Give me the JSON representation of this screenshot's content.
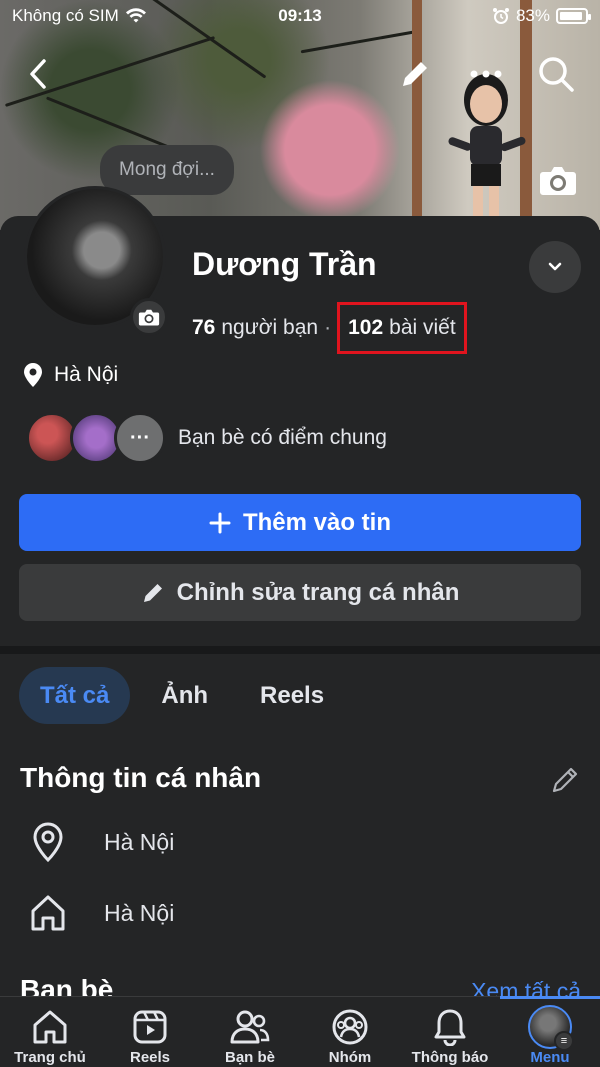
{
  "status_bar": {
    "carrier": "Không có SIM",
    "time": "09:13",
    "battery": "83%"
  },
  "cover": {
    "bubble_text": "Mong đợi..."
  },
  "profile": {
    "name": "Dương Trần",
    "friends_count": "76",
    "friends_label": "người bạn",
    "posts_count": "102",
    "posts_label": "bài viết",
    "location": "Hà Nội",
    "mutual_text": "Bạn bè có điểm chung",
    "mutual_more": "···"
  },
  "actions": {
    "add_story": "Thêm vào tin",
    "edit_profile": "Chỉnh sửa trang cá nhân"
  },
  "tabs": [
    {
      "label": "Tất cả",
      "active": true
    },
    {
      "label": "Ảnh",
      "active": false
    },
    {
      "label": "Reels",
      "active": false
    }
  ],
  "personal_info": {
    "title": "Thông tin cá nhân",
    "items": [
      {
        "icon": "location-pin-icon",
        "text": "Hà Nội"
      },
      {
        "icon": "home-icon",
        "text": "Hà Nội"
      }
    ]
  },
  "friends_section": {
    "title": "Bạn bè",
    "see_all": "Xem tất cả"
  },
  "bottom_nav": [
    {
      "label": "Trang chủ",
      "icon": "home-icon"
    },
    {
      "label": "Reels",
      "icon": "reels-icon"
    },
    {
      "label": "Bạn bè",
      "icon": "friends-icon"
    },
    {
      "label": "Nhóm",
      "icon": "groups-icon"
    },
    {
      "label": "Thông báo",
      "icon": "bell-icon"
    },
    {
      "label": "Menu",
      "icon": "menu-avatar",
      "active": true
    }
  ],
  "colors": {
    "accent": "#4a8af4",
    "primary_button": "#2d6cf5",
    "highlight_box": "#e0141e",
    "background": "#242526"
  }
}
